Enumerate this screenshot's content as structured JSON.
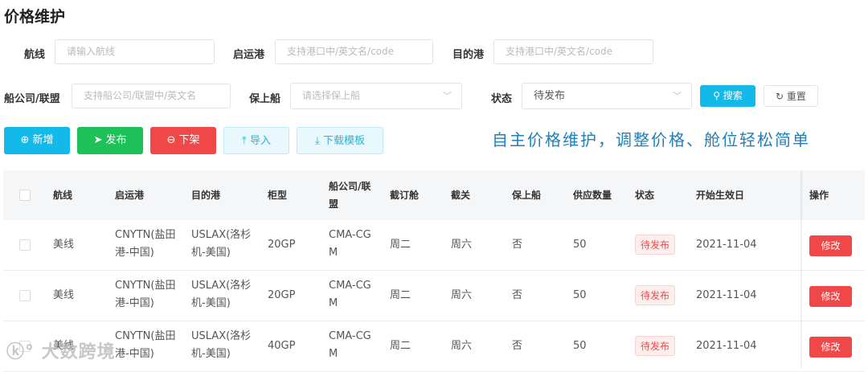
{
  "page_title": "价格维护",
  "filters": {
    "route": {
      "label": "航线",
      "placeholder": "请输入航线"
    },
    "origin": {
      "label": "启运港",
      "placeholder": "支持港口中/英文名/code"
    },
    "dest": {
      "label": "目的港",
      "placeholder": "支持港口中/英文名/code"
    },
    "carrier": {
      "label": "船公司/联盟",
      "placeholder": "支持船公司/联盟中/英文名"
    },
    "guarantee": {
      "label": "保上船",
      "placeholder": "请选择保上船"
    },
    "status": {
      "label": "状态",
      "value": "待发布"
    },
    "search": "搜索",
    "reset": "重置"
  },
  "actions": {
    "add": "新增",
    "publish": "发布",
    "offline": "下架",
    "import": "导入",
    "download": "下载模板"
  },
  "slogan": "自主价格维护，调整价格、舱位轻松简单",
  "table": {
    "headers": [
      "航线",
      "启运港",
      "目的港",
      "柜型",
      "船公司/联盟",
      "截订舱",
      "截关",
      "保上船",
      "供应数量",
      "状态",
      "开始生效日",
      "操作"
    ],
    "rows": [
      {
        "route": "美线",
        "origin": "CNYTN(盐田港-中国)",
        "dest": "USLAX(洛杉机-美国)",
        "type": "20GP",
        "carrier": "CMA-CGM",
        "booking": "周二",
        "cutoff": "周六",
        "guarantee": "否",
        "qty": "50",
        "status": "待发布",
        "date": "2021-11-04",
        "op": "修改"
      },
      {
        "route": "美线",
        "origin": "CNYTN(盐田港-中国)",
        "dest": "USLAX(洛杉机-美国)",
        "type": "20GP",
        "carrier": "CMA-CGM",
        "booking": "周二",
        "cutoff": "周六",
        "guarantee": "否",
        "qty": "50",
        "status": "待发布",
        "date": "2021-11-04",
        "op": "修改"
      },
      {
        "route": "美线",
        "origin": "CNYTN(盐田港-中国)",
        "dest": "USLAX(洛杉机-美国)",
        "type": "40GP",
        "carrier": "CMA-CGM",
        "booking": "周二",
        "cutoff": "周六",
        "guarantee": "否",
        "qty": "50",
        "status": "待发布",
        "date": "2021-11-04",
        "op": "修改"
      }
    ]
  },
  "watermark": "大数跨境"
}
